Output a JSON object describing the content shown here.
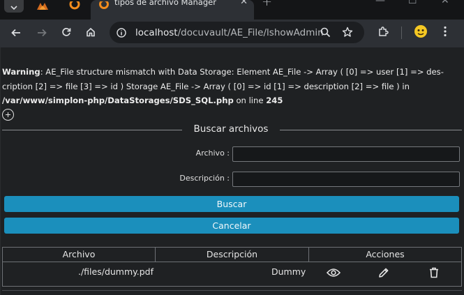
{
  "browser": {
    "tab_title": "tipos de archivo Manager",
    "url_host": "localhost",
    "url_path": "/docuvault/AE_File/lshowAdmin"
  },
  "warning": {
    "label": "Warning",
    "message": ": AE_File structure mismatch with Data Storage: Element AE_File -> Array ( [0] => user [1] => des-cription [2] => file [3] => id ) Storage AE_File -> Array ( [0] => id [1] => description [2] => file ) in ",
    "file": "/var/www/simplon-php/DataStorages/SDS_SQL.php",
    "line_text": " on line ",
    "line": "245"
  },
  "form": {
    "legend": "Buscar archivos",
    "archivo_label": "Archivo :",
    "descripcion_label": "Descripción :",
    "archivo_value": "",
    "descripcion_value": "",
    "search_button": "Buscar",
    "cancel_button": "Cancelar"
  },
  "table": {
    "headers": [
      "Archivo",
      "Descripción",
      "Acciones"
    ],
    "rows": [
      {
        "archivo": "./files/dummy.pdf",
        "descripcion": "Dummy"
      }
    ]
  },
  "icons": [
    "menu-chevron-icon",
    "xampp-icon",
    "apache-icon",
    "back-icon",
    "forward-icon",
    "reload-icon",
    "home-icon",
    "site-info-icon",
    "zoom-icon",
    "bookmark-star-icon",
    "extensions-icon",
    "profile-icon",
    "more-menu-icon",
    "add-circle-icon",
    "view-eye-icon",
    "edit-pencil-icon",
    "delete-trash-icon"
  ],
  "colors": {
    "button_bg": "#1b8fbc",
    "page_bg": "#1f2123",
    "tab_active_bg": "#2d3035"
  }
}
